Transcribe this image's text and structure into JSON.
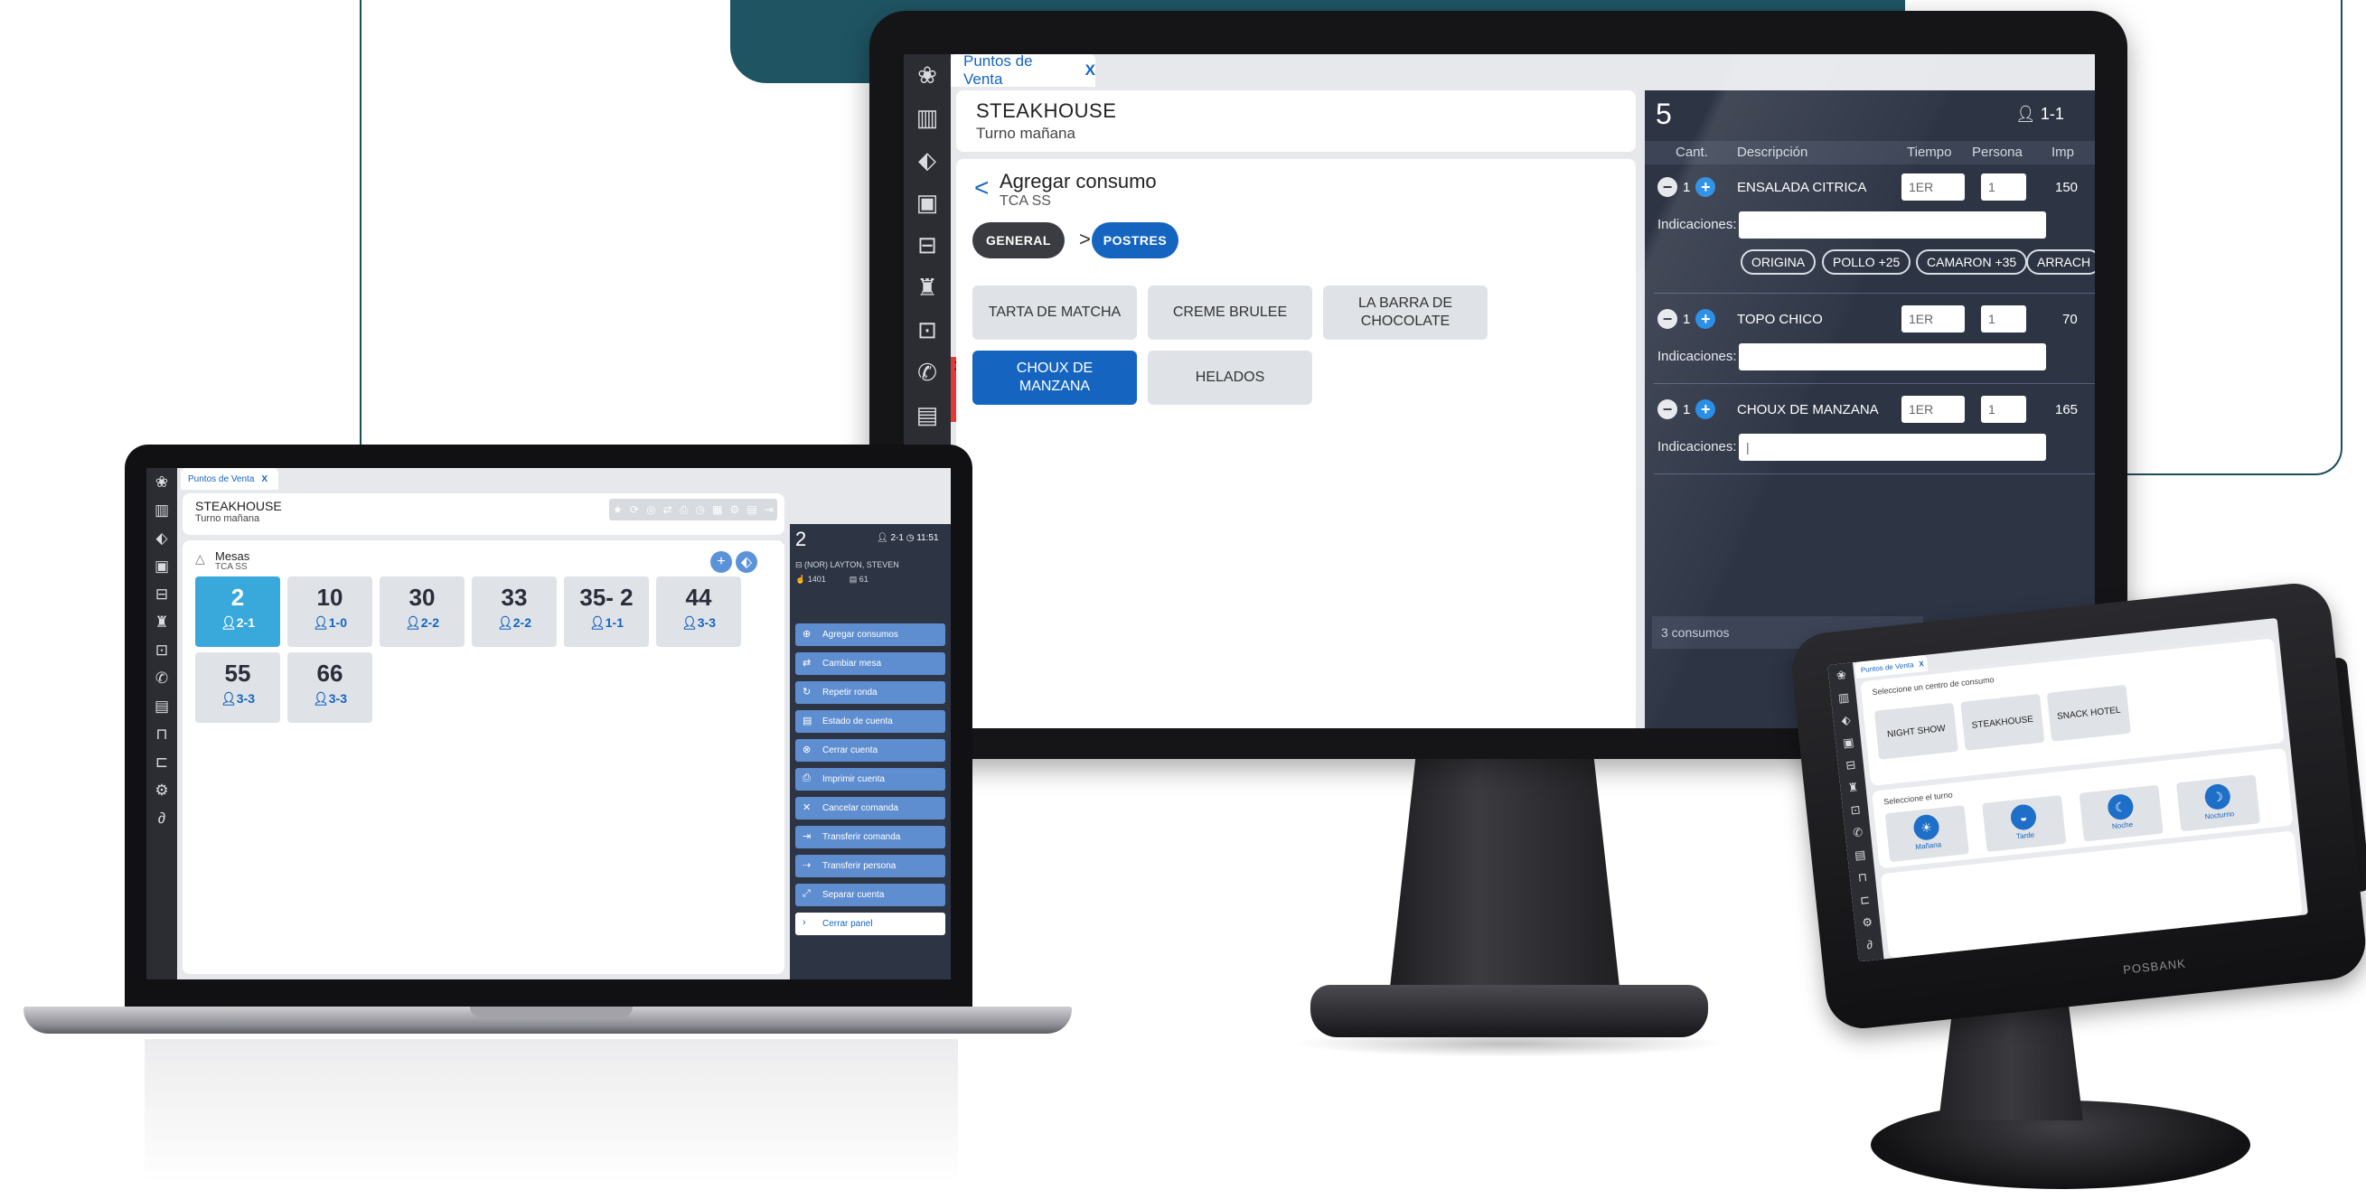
{
  "monitor": {
    "tab_label": "Puntos de Venta",
    "tab_close": "X",
    "rail_icons": [
      "lotus-icon",
      "chart-icon",
      "tag-icon",
      "calendar-icon",
      "briefcase-icon",
      "chef-icon",
      "clipboard-icon",
      "phone-icon",
      "cash-register-icon"
    ],
    "handle_glyph": ">",
    "venue": "STEAKHOUSE",
    "shift": "Turno mañana",
    "back_glyph": "<",
    "section_title": "Agregar consumo",
    "section_sub": "TCA SS",
    "crumbs": [
      "GENERAL",
      "POSTRES"
    ],
    "crumb_sep": ">",
    "products": [
      "TARTA DE MATCHA",
      "CREME BRULEE",
      "LA BARRA DE CHOCOLATE",
      "CHOUX DE MANZANA",
      "HELADOS"
    ],
    "panel": {
      "number": "5",
      "people": "1-1",
      "headers": [
        "Cant.",
        "Descripción",
        "Tiempo",
        "Persona",
        "Imp"
      ],
      "lines": [
        {
          "qty": "1",
          "desc": "ENSALADA CITRICA",
          "time": "1ER",
          "person": "1",
          "amount": "150",
          "label": "Indicaciones:",
          "chips": [
            "ORIGINA",
            "POLLO +25",
            "CAMARON +35",
            "ARRACH"
          ]
        },
        {
          "qty": "1",
          "desc": "TOPO CHICO",
          "time": "1ER",
          "person": "1",
          "amount": "70",
          "label": "Indicaciones:",
          "chips": []
        },
        {
          "qty": "1",
          "desc": "CHOUX DE MANZANA",
          "time": "1ER",
          "person": "1",
          "amount": "165",
          "label": "Indicaciones:",
          "chips": []
        }
      ],
      "footer": "3 consumos"
    }
  },
  "laptop": {
    "tab_label": "Puntos de Venta",
    "tab_close": "X",
    "rail_icons": [
      "lotus-icon",
      "chart-icon",
      "tag-icon",
      "calendar-icon",
      "briefcase-icon",
      "chef-icon",
      "clipboard-icon",
      "phone-icon",
      "cash-register-icon",
      "bag-icon",
      "bus-icon",
      "settings-icon",
      "clip-icon"
    ],
    "handle_glyph": ">",
    "venue": "STEAKHOUSE",
    "shift": "Turno mañana",
    "section_title": "Mesas",
    "section_sub": "TCA SS",
    "add_glyph": "+",
    "tables": [
      {
        "number": "2",
        "people": "2-1"
      },
      {
        "number": "10",
        "people": "1-0"
      },
      {
        "number": "30",
        "people": "2-2"
      },
      {
        "number": "33",
        "people": "2-2"
      },
      {
        "number": "35- 2",
        "people": "1-1"
      },
      {
        "number": "44",
        "people": "3-3"
      },
      {
        "number": "55",
        "people": "3-3"
      },
      {
        "number": "66",
        "people": "3-3"
      }
    ],
    "panel": {
      "number": "2",
      "people": "2-1",
      "time": "11:51",
      "waiter": "(NOR) LAYTON, STEVEN",
      "folio": "1401",
      "ticket": "61",
      "actions": [
        "Agregar consumos",
        "Cambiar mesa",
        "Repetir ronda",
        "Estado de cuenta",
        "Cerrar cuenta",
        "Imprimir cuenta",
        "Cancelar comanda",
        "Transferir comanda",
        "Transferir persona",
        "Separar cuenta",
        "Cerrar panel"
      ]
    }
  },
  "pos": {
    "tab_label": "Puntos de Venta",
    "tab_close": "X",
    "center_label": "Seleccione un centro de consumo",
    "centers": [
      "NIGHT SHOW",
      "STEAKHOUSE",
      "SNACK HOTEL"
    ],
    "shift_label": "Seleccione el turno",
    "shifts": [
      "Mañana",
      "Tarde",
      "Noche",
      "Nocturno"
    ],
    "brand": "POSBANK"
  },
  "colors": {
    "accent": "#1565c0",
    "panel": "#2d3444",
    "teal": "#1f5463",
    "handle": "#e53935"
  }
}
